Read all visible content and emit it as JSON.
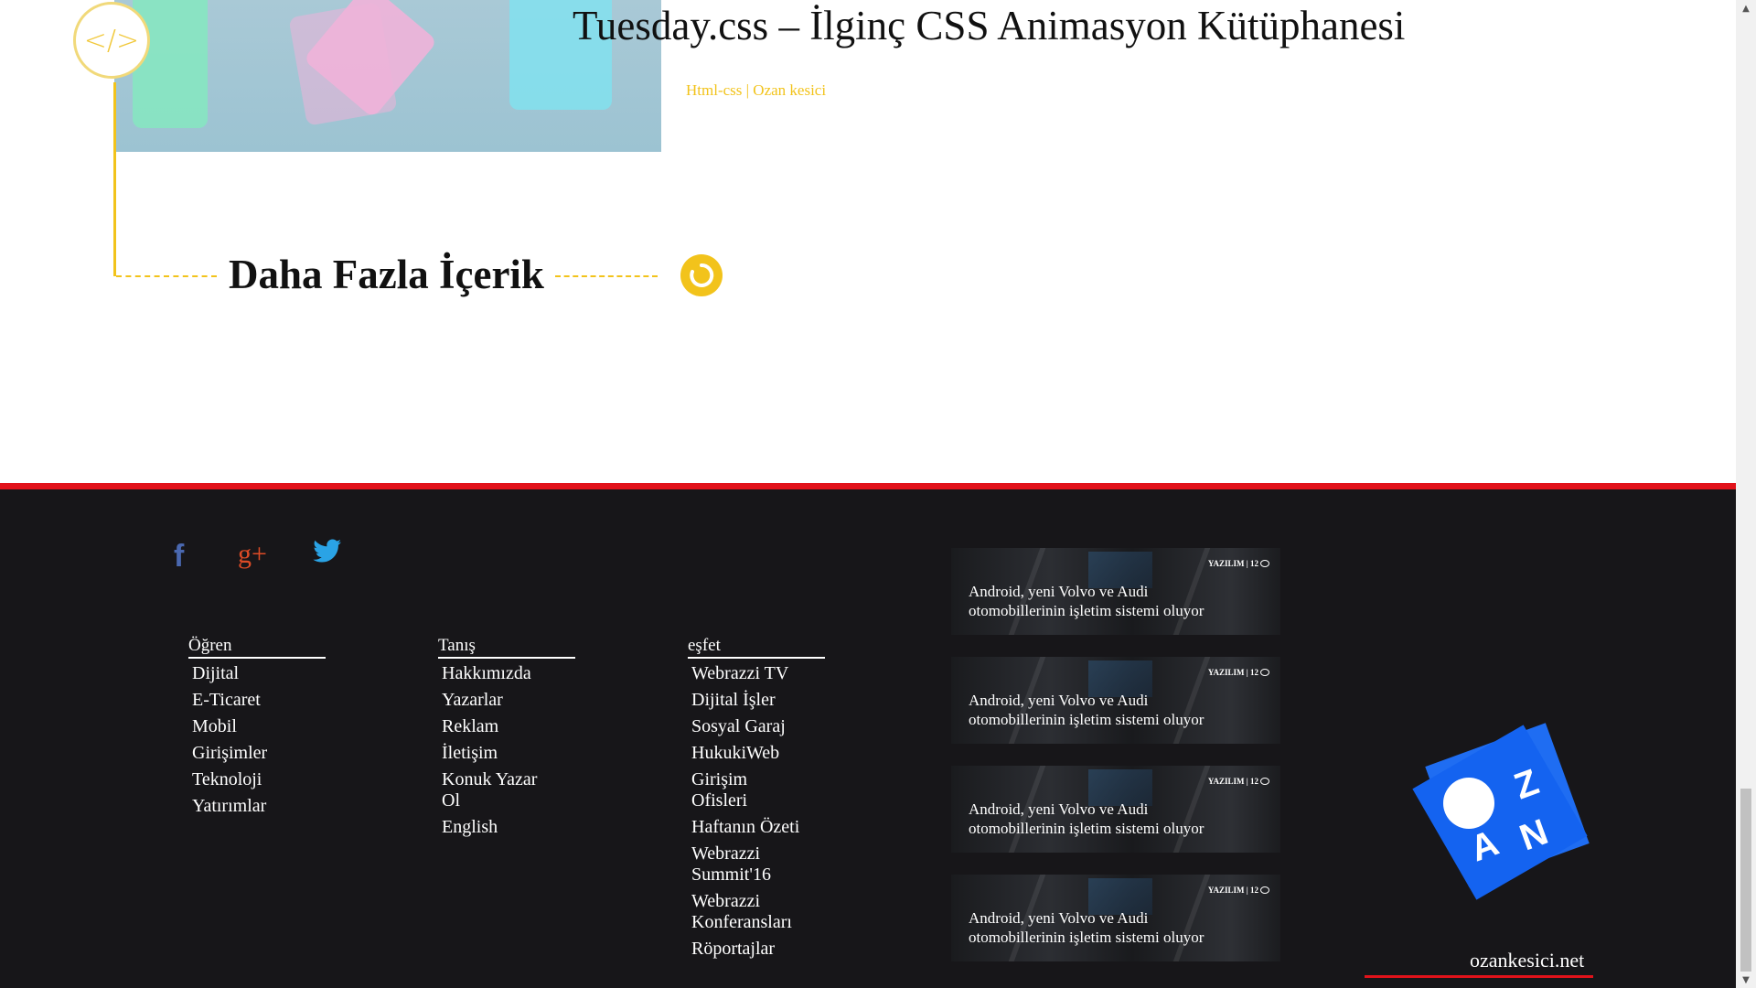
{
  "post": {
    "title": "Tuesday.css – İlginç CSS Animasyon Kütüphanesi",
    "meta": "Html-css | Ozan kesici",
    "badge_icon": "code-icon",
    "badge_text": "</>"
  },
  "more": {
    "title": "Daha Fazla İçerik",
    "button_icon": "refresh-icon"
  },
  "footer": {
    "social": [
      {
        "name": "facebook-icon",
        "glyph": "f"
      },
      {
        "name": "google-plus-icon",
        "glyph": "g+"
      },
      {
        "name": "twitter-icon"
      }
    ],
    "columns": [
      {
        "heading": "Öğren",
        "items": [
          "Dijital",
          "E-Ticaret",
          "Mobil",
          "Girişimler",
          "Teknoloji",
          "Yatırımlar"
        ]
      },
      {
        "heading": "Tanış",
        "items": [
          "Hakkımızda",
          "Yazarlar",
          "Reklam",
          "İletişim",
          "Konuk Yazar Ol",
          "English"
        ]
      },
      {
        "heading": "eşfet",
        "items": [
          "Webrazzi TV",
          "Dijital İşler",
          "Sosyal Garaj",
          "HukukiWeb",
          "Girişim Ofisleri",
          "Haftanın Özeti",
          "Webrazzi Summit'16",
          "Webrazzi Konferansları",
          "Röportajlar"
        ]
      }
    ],
    "news": [
      {
        "tag": "YAZILIM | 12",
        "title": "Android, yeni Volvo ve Audi otomobillerinin işletim sistemi oluyor"
      },
      {
        "tag": "YAZILIM | 12",
        "title": "Android, yeni Volvo ve Audi otomobillerinin işletim sistemi oluyor"
      },
      {
        "tag": "YAZILIM | 12",
        "title": "Android, yeni Volvo ve Audi otomobillerinin işletim sistemi oluyor"
      },
      {
        "tag": "YAZILIM | 12",
        "title": "Android, yeni Volvo ve Audi otomobillerinin işletim sistemi oluyor"
      }
    ],
    "brand": {
      "logo_letters": [
        "Z",
        "A",
        "N"
      ],
      "site": "ozankesici.net"
    }
  },
  "colors": {
    "accent_yellow": "#f2c31b",
    "footer_bg": "#171619",
    "footer_border_red": "#e1121a",
    "logo_blue": "#1463f0"
  }
}
